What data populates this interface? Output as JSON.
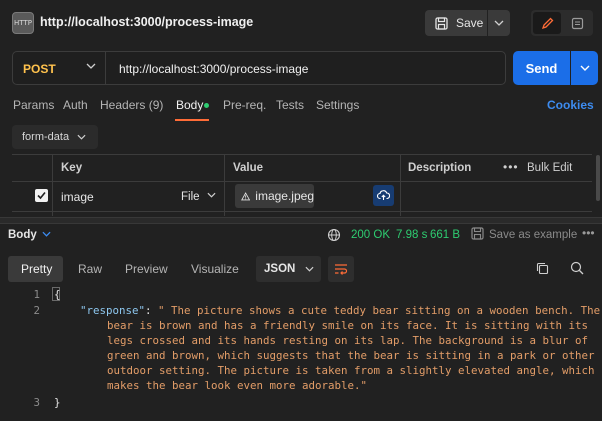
{
  "header": {
    "badge_text": "HTTP",
    "title": "http://localhost:3000/process-image",
    "save_label": "Save"
  },
  "request": {
    "method": "POST",
    "url": "http://localhost:3000/process-image",
    "send_label": "Send"
  },
  "tabs": [
    {
      "label": "Params"
    },
    {
      "label": "Auth"
    },
    {
      "label": "Headers (9)"
    },
    {
      "label": "Body"
    },
    {
      "label": "Pre-req."
    },
    {
      "label": "Tests"
    },
    {
      "label": "Settings"
    }
  ],
  "cookies_label": "Cookies",
  "body_mode": "form-data",
  "table": {
    "headers": {
      "key": "Key",
      "value": "Value",
      "description": "Description",
      "bulk_edit": "Bulk Edit"
    },
    "rows": [
      {
        "checked": true,
        "key": "image",
        "type": "File",
        "value": "image.jpeg"
      }
    ]
  },
  "response": {
    "label": "Body",
    "status": "200 OK",
    "time": "7.98 s",
    "size": "661 B",
    "save_example": "Save as example",
    "view_tabs": [
      {
        "label": "Pretty"
      },
      {
        "label": "Raw"
      },
      {
        "label": "Preview"
      },
      {
        "label": "Visualize"
      }
    ],
    "format": "JSON",
    "line_numbers": [
      "1",
      "2",
      "3"
    ],
    "open_brace": "{",
    "close_brace": "}",
    "json_key": "\"response\"",
    "json_colon": ":",
    "json_value_lines": [
      "\" The picture shows a cute teddy bear sitting on a wooden bench. The",
      "bear is brown and has a friendly smile on its face. It is sitting with its",
      "legs crossed and its hands resting on its lap. The background is a blur of",
      "green and brown, which suggests that the bear is sitting in a park or other",
      "outdoor setting. The picture is taken from a slightly elevated angle, which",
      "makes the bear look even more adorable.\""
    ]
  }
}
